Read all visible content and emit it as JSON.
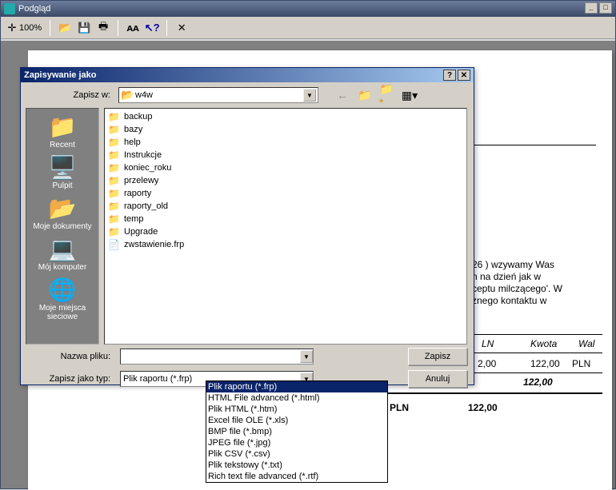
{
  "main_title": "Podgląd",
  "toolbar": {
    "zoom": "100%"
  },
  "dialog": {
    "title": "Zapisywanie jako",
    "save_in_label": "Zapisz w:",
    "save_in_value": "w4w",
    "filename_label": "Nazwa pliku:",
    "filename_value": "",
    "filetype_label": "Zapisz jako typ:",
    "filetype_value": "Plik raportu (*.frp)",
    "save_btn": "Zapisz",
    "cancel_btn": "Anuluj"
  },
  "places": [
    {
      "label": "Recent",
      "icon": "📁"
    },
    {
      "label": "Pulpit",
      "icon": "🖥️"
    },
    {
      "label": "Moje dokumenty",
      "icon": "📂"
    },
    {
      "label": "Mój komputer",
      "icon": "💻"
    },
    {
      "label": "Moje miejsca sieciowe",
      "icon": "🌐"
    }
  ],
  "files": [
    {
      "name": "backup",
      "type": "folder"
    },
    {
      "name": "bazy",
      "type": "folder"
    },
    {
      "name": "help",
      "type": "folder"
    },
    {
      "name": "Instrukcje",
      "type": "folder"
    },
    {
      "name": "koniec_roku",
      "type": "folder"
    },
    {
      "name": "przelewy",
      "type": "folder"
    },
    {
      "name": "raporty",
      "type": "folder"
    },
    {
      "name": "raporty_old",
      "type": "folder"
    },
    {
      "name": "temp",
      "type": "folder"
    },
    {
      "name": "Upgrade",
      "type": "folder"
    },
    {
      "name": "zwstawienie.frp",
      "type": "file"
    }
  ],
  "filetypes": [
    "Plik raportu (*.frp)",
    "HTML File advanced (*.html)",
    "Plik HTML (*.htm)",
    "Excel file OLE (*.xls)",
    "BMP file (*.bmp)",
    "JPEG file (*.jpg)",
    "Plik CSV (*.csv)",
    "Plik tekstowy (*.txt)",
    "Rich text file advanced (*.rtf)"
  ],
  "bg": {
    "line1": "26 ) wzywamy Was",
    "line2": "n na dzień jak w",
    "line3": "ceptu milczącego'. W",
    "line4": "znego kontaktu w",
    "hdr1": "LN",
    "hdr2": "Kwota",
    "hdr3": "Wal",
    "r1a": "2,00",
    "r1b": "122,00",
    "r1c": "PLN",
    "r2b": "122,00",
    "sum1": "PLN",
    "sum2": "122,00"
  }
}
